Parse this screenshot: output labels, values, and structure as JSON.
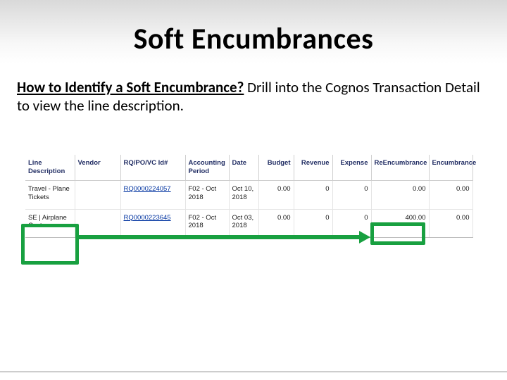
{
  "title": "Soft Encumbrances",
  "body": {
    "lead": "How to Identify a Soft Encumbrance?",
    "tail": " Drill into the Cognos Transaction Detail to view the line description."
  },
  "table": {
    "headers": {
      "line": "Line Description",
      "vendor": "Vendor",
      "rq": "RQ/PO/VC Id#",
      "ap": "Accounting Period",
      "date": "Date",
      "budget": "Budget",
      "revenue": "Revenue",
      "expense": "Expense",
      "reenc": "ReEncumbrance",
      "enc": "Encumbrance"
    },
    "rows": [
      {
        "line": "Travel - Plane Tickets",
        "vendor": "",
        "rq": "RQ0000224057",
        "ap": "F02 - Oct 2018",
        "date": "Oct 10, 2018",
        "budget": "0.00",
        "revenue": "0",
        "expense": "0",
        "reenc": "0.00",
        "enc": "0.00"
      },
      {
        "line": "SE | Airplane Cost",
        "vendor": "",
        "rq": "RQ0000223645",
        "ap": "F02 - Oct 2018",
        "date": "Oct 03, 2018",
        "budget": "0.00",
        "revenue": "0",
        "expense": "0",
        "reenc": "400.00",
        "enc": "0.00"
      }
    ]
  },
  "highlight": {
    "color": "#18a040"
  }
}
